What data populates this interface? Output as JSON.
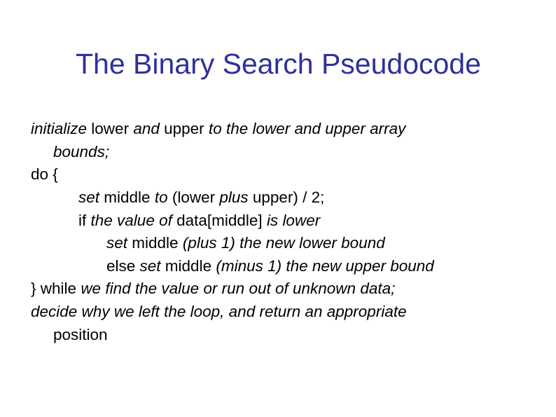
{
  "title": "The Binary Search Pseudocode",
  "lines": {
    "l1a": "initialize",
    "l1b": " lower ",
    "l1c": "and",
    "l1d": " upper ",
    "l1e": "to the lower and upper array",
    "l2": "bounds;",
    "l3": "do {",
    "l4a": "set",
    "l4b": " middle ",
    "l4c": "to",
    "l4d": " (lower ",
    "l4e": "plus",
    "l4f": " upper) / 2;",
    "l5a": "if ",
    "l5b": "the value of ",
    "l5c": "data[middle] ",
    "l5d": "is lower",
    "l6a": "set",
    "l6b": " middle ",
    "l6c": "(plus 1) the new lower bound",
    "l7a": "else ",
    "l7b": "set",
    "l7c": " middle ",
    "l7d": "(minus 1) the new upper bound",
    "l8a": "} ",
    "l8b": "while ",
    "l8c": "we find the value or run out of unknown data;",
    "l9": "decide why we left the loop, and return an appropriate",
    "l10": "position"
  }
}
